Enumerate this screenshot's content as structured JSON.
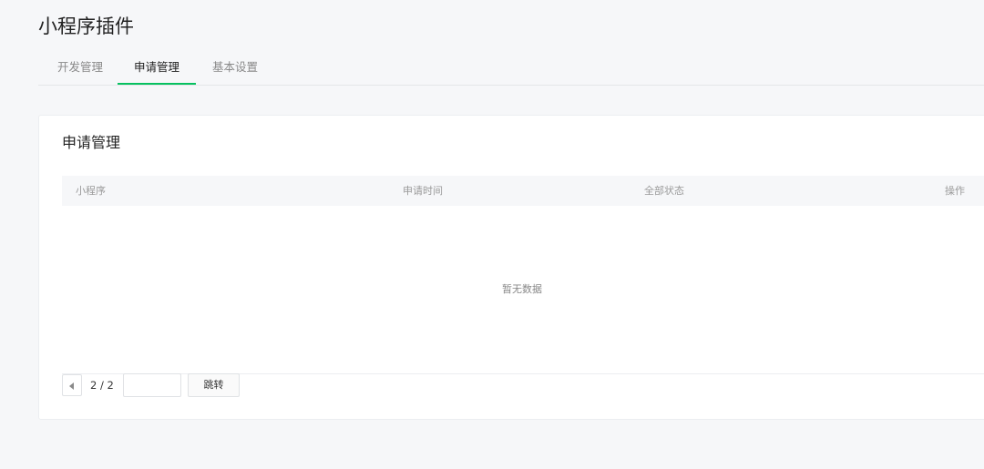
{
  "page": {
    "title": "小程序插件"
  },
  "tabs": [
    {
      "label": "开发管理",
      "active": false
    },
    {
      "label": "申请管理",
      "active": true
    },
    {
      "label": "基本设置",
      "active": false
    }
  ],
  "card": {
    "title": "申请管理",
    "table": {
      "columns": [
        "小程序",
        "申请时间",
        "全部状态",
        "操作"
      ],
      "rows": [],
      "empty_text": "暂无数据"
    },
    "pagination": {
      "page_label": "2 / 2",
      "jump_input_value": "",
      "jump_label": "跳转"
    }
  },
  "colors": {
    "accent": "#07c160",
    "background": "#f6f7f9"
  },
  "icons": {
    "prev": "triangle-left-icon"
  }
}
